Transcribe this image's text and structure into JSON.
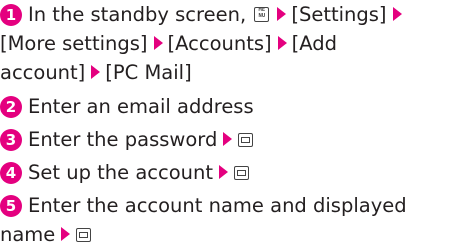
{
  "steps": [
    {
      "number": "1",
      "line1_prefix": "In the standby screen,",
      "line1_items": [
        "[Settings]"
      ],
      "line2_items": [
        "[More settings]",
        "[Accounts]",
        "[Add"
      ],
      "line3_text": "account]",
      "line3_after": "[PC Mail]"
    },
    {
      "number": "2",
      "text": "Enter an email address"
    },
    {
      "number": "3",
      "text": "Enter the password"
    },
    {
      "number": "4",
      "text": "Set up the account"
    },
    {
      "number": "5",
      "line1": "Enter the account name and displayed",
      "line2": "name"
    }
  ],
  "icons": {
    "menu_key": "menu-key-icon",
    "arrow": "arrow-right-icon",
    "ok_key": "ok-key-icon"
  },
  "colors": {
    "accent": "#e4007f",
    "text": "#231f20"
  }
}
